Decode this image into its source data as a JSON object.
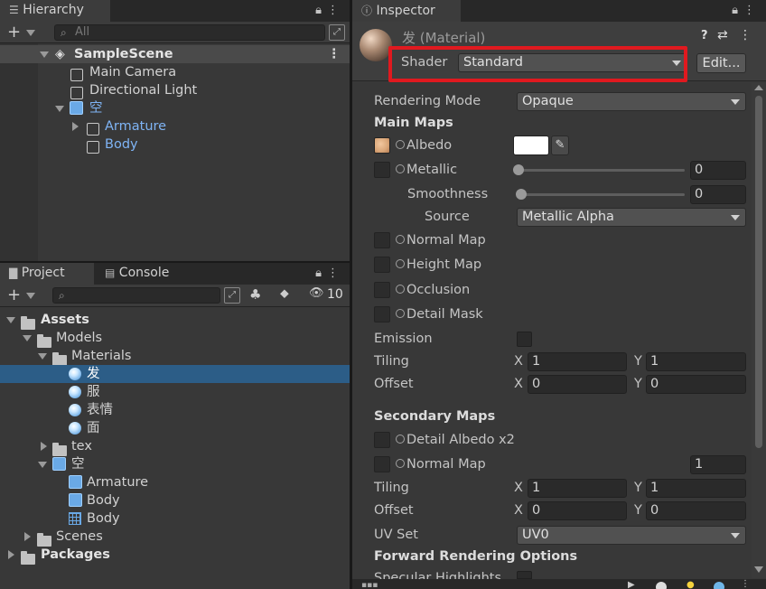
{
  "hierarchy": {
    "tab_label": "Hierarchy",
    "search_placeholder": "All",
    "items": [
      {
        "label": "SampleScene"
      },
      {
        "label": "Main Camera"
      },
      {
        "label": "Directional Light"
      },
      {
        "label": "空"
      },
      {
        "label": "Armature"
      },
      {
        "label": "Body"
      }
    ]
  },
  "project": {
    "tab_label": "Project",
    "console_tab_label": "Console",
    "hidden_count": "10",
    "items": [
      {
        "label": "Assets"
      },
      {
        "label": "Models"
      },
      {
        "label": "Materials"
      },
      {
        "label": "发"
      },
      {
        "label": "服"
      },
      {
        "label": "表情"
      },
      {
        "label": "面"
      },
      {
        "label": "tex"
      },
      {
        "label": "空"
      },
      {
        "label": "Armature"
      },
      {
        "label": "Body"
      },
      {
        "label": "Body"
      },
      {
        "label": "Scenes"
      },
      {
        "label": "Packages"
      }
    ]
  },
  "inspector": {
    "tab_label": "Inspector",
    "material_title": "发 (Material)",
    "shader_label": "Shader",
    "shader_value": "Standard",
    "edit_button": "Edit...",
    "rendering_mode_label": "Rendering Mode",
    "rendering_mode_value": "Opaque",
    "main_maps_header": "Main Maps",
    "albedo_label": "Albedo",
    "metallic_label": "Metallic",
    "metallic_value": "0",
    "metallic_fraction": 0,
    "smoothness_label": "Smoothness",
    "smoothness_value": "0",
    "smoothness_fraction": 0,
    "source_label": "Source",
    "source_value": "Metallic Alpha",
    "normal_map_label": "Normal Map",
    "height_map_label": "Height Map",
    "occlusion_label": "Occlusion",
    "detail_mask_label": "Detail Mask",
    "emission_label": "Emission",
    "tiling_label": "Tiling",
    "offset_label": "Offset",
    "x_label": "X",
    "y_label": "Y",
    "main_tiling_x": "1",
    "main_tiling_y": "1",
    "main_offset_x": "0",
    "main_offset_y": "0",
    "secondary_maps_header": "Secondary Maps",
    "detail_albedo_label": "Detail Albedo x2",
    "sec_normal_map_label": "Normal Map",
    "sec_normal_value": "1",
    "sec_tiling_x": "1",
    "sec_tiling_y": "1",
    "sec_offset_x": "0",
    "sec_offset_y": "0",
    "uv_set_label": "UV Set",
    "uv_set_value": "UV0",
    "forward_header": "Forward Rendering Options",
    "specular_label": "Specular Highlights"
  },
  "colors": {
    "selection": "#2c5d87",
    "highlight_box": "#e0191f",
    "link_blue": "#7fb4f5"
  }
}
